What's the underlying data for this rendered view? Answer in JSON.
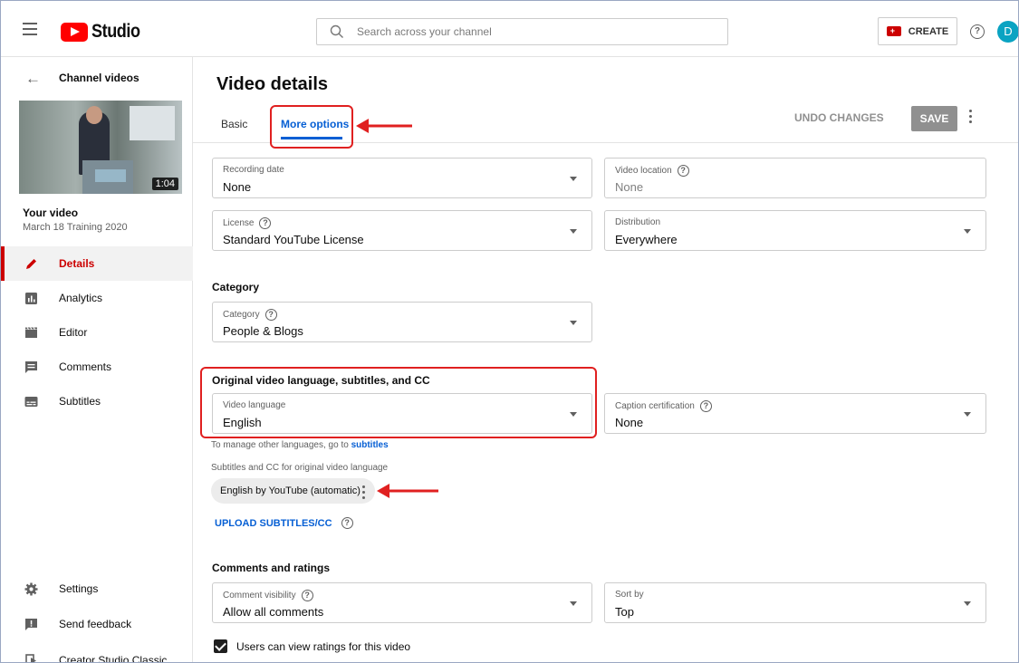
{
  "header": {
    "logo_text": "Studio",
    "search_placeholder": "Search across your channel",
    "create_label": "CREATE",
    "avatar_initial": "D"
  },
  "sidebar": {
    "back_title": "Channel videos",
    "video_duration": "1:04",
    "your_video_label": "Your video",
    "video_title": "March 18 Training 2020",
    "items": [
      {
        "label": "Details",
        "icon": "pencil-icon"
      },
      {
        "label": "Analytics",
        "icon": "analytics-icon"
      },
      {
        "label": "Editor",
        "icon": "clapperboard-icon"
      },
      {
        "label": "Comments",
        "icon": "comment-icon"
      },
      {
        "label": "Subtitles",
        "icon": "subtitles-icon"
      }
    ],
    "bottom_items": [
      {
        "label": "Settings",
        "icon": "gear-icon"
      },
      {
        "label": "Send feedback",
        "icon": "feedback-icon"
      },
      {
        "label": "Creator Studio Classic",
        "icon": "exit-icon"
      }
    ]
  },
  "main": {
    "page_title": "Video details",
    "tabs": [
      "Basic",
      "More options"
    ],
    "undo_label": "UNDO CHANGES",
    "save_label": "SAVE",
    "fields": {
      "recording_date": {
        "label": "Recording date",
        "value": "None"
      },
      "video_location": {
        "label": "Video location",
        "value": "None"
      },
      "license": {
        "label": "License",
        "value": "Standard YouTube License"
      },
      "distribution": {
        "label": "Distribution",
        "value": "Everywhere"
      },
      "category": {
        "label": "Category",
        "value": "People & Blogs"
      },
      "video_language": {
        "label": "Video language",
        "value": "English"
      },
      "caption_certification": {
        "label": "Caption certification",
        "value": "None"
      },
      "comment_visibility": {
        "label": "Comment visibility",
        "value": "Allow all comments"
      },
      "sort_by": {
        "label": "Sort by",
        "value": "Top"
      }
    },
    "category_heading": "Category",
    "language_heading": "Original video language, subtitles, and CC",
    "manage_note_prefix": "To manage other languages, go to",
    "manage_note_link": "subtitles",
    "subtitles_note": "Subtitles and CC for original video language",
    "subtitle_chip": "English by YouTube (automatic)",
    "upload_label": "UPLOAD SUBTITLES/CC",
    "comments_heading": "Comments and ratings",
    "ratings_checkbox_label": "Users can view ratings for this video",
    "ratings_checked": true
  },
  "colors": {
    "accent_blue": "#065fd4",
    "brand_red": "#ff0000",
    "annotation_red": "#e02020"
  }
}
